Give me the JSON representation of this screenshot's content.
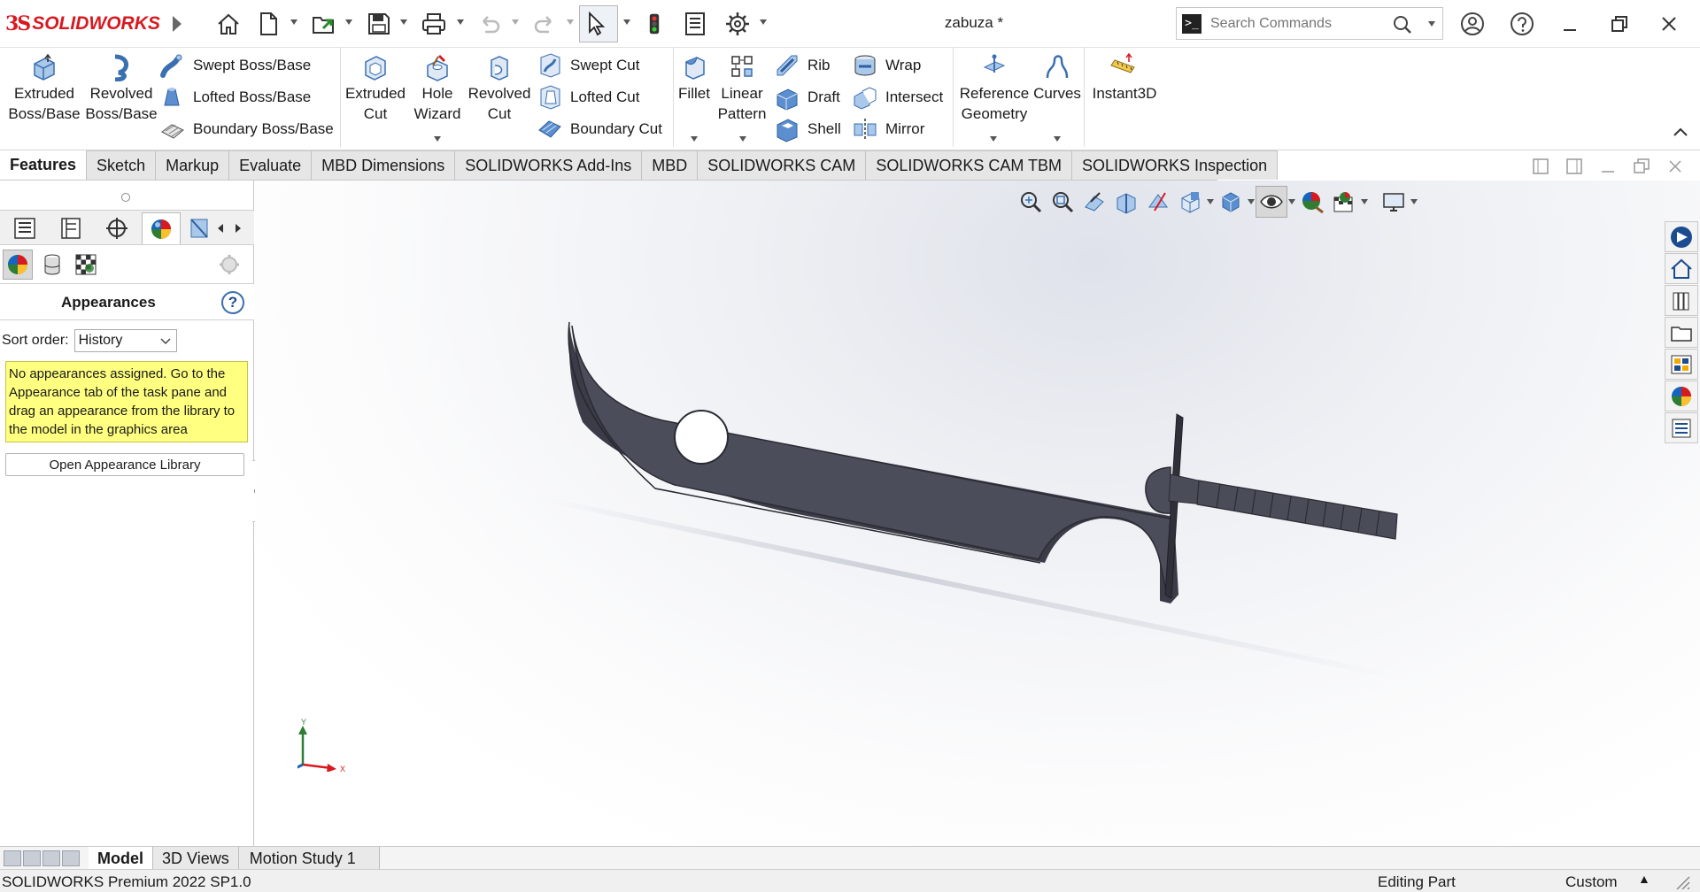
{
  "app": {
    "brand_ds": "3S",
    "brand_name": "SOLIDWORKS",
    "document_title": "zabuza *"
  },
  "search": {
    "placeholder": "Search Commands"
  },
  "ribbon": {
    "extruded_boss": [
      "Extruded",
      "Boss/Base"
    ],
    "revolved_boss": [
      "Revolved",
      "Boss/Base"
    ],
    "swept_boss": "Swept Boss/Base",
    "lofted_boss": "Lofted Boss/Base",
    "boundary_boss": "Boundary Boss/Base",
    "extruded_cut": [
      "Extruded",
      "Cut"
    ],
    "hole_wizard": [
      "Hole",
      "Wizard"
    ],
    "revolved_cut": [
      "Revolved",
      "Cut"
    ],
    "swept_cut": "Swept Cut",
    "lofted_cut": "Lofted Cut",
    "boundary_cut": "Boundary Cut",
    "fillet": "Fillet",
    "linear_pattern": [
      "Linear",
      "Pattern"
    ],
    "rib": "Rib",
    "draft": "Draft",
    "shell": "Shell",
    "wrap": "Wrap",
    "intersect": "Intersect",
    "mirror": "Mirror",
    "reference_geometry": [
      "Reference",
      "Geometry"
    ],
    "curves": "Curves",
    "instant3d": "Instant3D"
  },
  "command_tabs": [
    "Features",
    "Sketch",
    "Markup",
    "Evaluate",
    "MBD Dimensions",
    "SOLIDWORKS Add-Ins",
    "MBD",
    "SOLIDWORKS CAM",
    "SOLIDWORKS CAM TBM",
    "SOLIDWORKS Inspection"
  ],
  "panel": {
    "title": "Appearances",
    "help": "?",
    "sort_label": "Sort order:",
    "sort_value": "History",
    "note": "No appearances assigned. Go to the Appearance tab of the task pane and drag an appearance from the library to the model in the graphics area",
    "open_library": "Open Appearance Library"
  },
  "triad": {
    "y": "Y",
    "x": "X"
  },
  "bottom_tabs": [
    "Model",
    "3D Views",
    "Motion Study 1"
  ],
  "status": {
    "version": "SOLIDWORKS Premium 2022 SP1.0",
    "mode": "Editing Part",
    "units": "Custom",
    "units_arrow": "▲"
  },
  "colors": {
    "brand_red": "#d71920",
    "model_fill": "#4a4c58",
    "note_bg": "#ffff80"
  }
}
